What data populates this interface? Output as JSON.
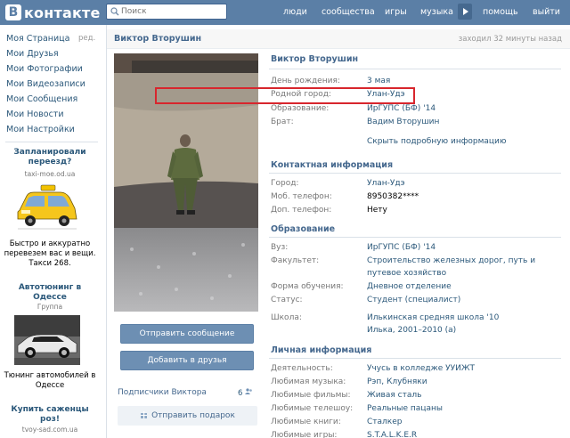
{
  "header": {
    "logo_letter": "В",
    "logo_text": "контакте",
    "search_placeholder": "Поиск",
    "nav": [
      "люди",
      "сообщества",
      "игры",
      "музыка",
      "помощь",
      "выйти"
    ],
    "bg_color": "#5b7fa6"
  },
  "sidebar": {
    "items": [
      "Моя Страница",
      "Мои Друзья",
      "Мои Фотографии",
      "Мои Видеозаписи",
      "Мои Сообщения",
      "Мои Новости",
      "Мои Настройки"
    ],
    "edit_label": "ред.",
    "ads": [
      {
        "title": "Запланировали переезд?",
        "sub": "taxi-moe.od.ua",
        "text": "Быстро и аккуратно перевезем вас и вещи. Такси 268."
      },
      {
        "title": "Автотюнинг в Одессе",
        "sub": "Группа",
        "text": "Тюнинг автомобилей в Одессе"
      },
      {
        "title": "Купить саженцы роз!",
        "sub": "tvoy-sad.com.ua"
      }
    ]
  },
  "profile": {
    "name": "Виктор Вторушин",
    "last_seen": "заходил 32 минуты назад",
    "buttons": {
      "message": "Отправить сообщение",
      "add_friend": "Добавить в друзья"
    },
    "followers_label": "Подписчики Виктора",
    "followers_count": "6",
    "gift_label": "Отправить подарок",
    "basic": {
      "birthday_label": "День рождения:",
      "birthday": "3 мая",
      "hometown_label": "Родной город:",
      "hometown": "Улан-Удэ",
      "education_label": "Образование:",
      "education": "ИрГУПС (БФ) '14",
      "brother_label": "Брат:",
      "brother": "Вадим Вторушин",
      "toggle": "Скрыть подробную информацию"
    },
    "contacts": {
      "title": "Контактная информация",
      "city_label": "Город:",
      "city": "Улан-Удэ",
      "mobile_label": "Моб. телефон:",
      "mobile": "8950382****",
      "extra_label": "Доп. телефон:",
      "extra": "Нету"
    },
    "education": {
      "title": "Образование",
      "uni_label": "Вуз:",
      "uni": "ИрГУПС (БФ) '14",
      "faculty_label": "Факультет:",
      "faculty_1": "Строительство железных дорог, путь и",
      "faculty_2": "путевое хозяйство",
      "form_label": "Форма обучения:",
      "form": "Дневное отделение",
      "status_label": "Статус:",
      "status": "Студент (специалист)",
      "school_label": "Школа:",
      "school": "Илькинская средняя школа '10",
      "school_2": "Илька, 2001–2010 (а)"
    },
    "personal": {
      "title": "Личная информация",
      "activity_label": "Деятельность:",
      "activity": "Учусь в колледже УУИЖТ",
      "music_label": "Любимая музыка:",
      "music": "Рэп, Клубняки",
      "films_label": "Любимые фильмы:",
      "films": "Живая сталь",
      "tv_label": "Любимые телешоу:",
      "tv": "Реальные пацаны",
      "books_label": "Любимые книги:",
      "books": "Сталкер",
      "games_label": "Любимые игры:",
      "games": "S.T.A.L.K.E.R"
    }
  }
}
